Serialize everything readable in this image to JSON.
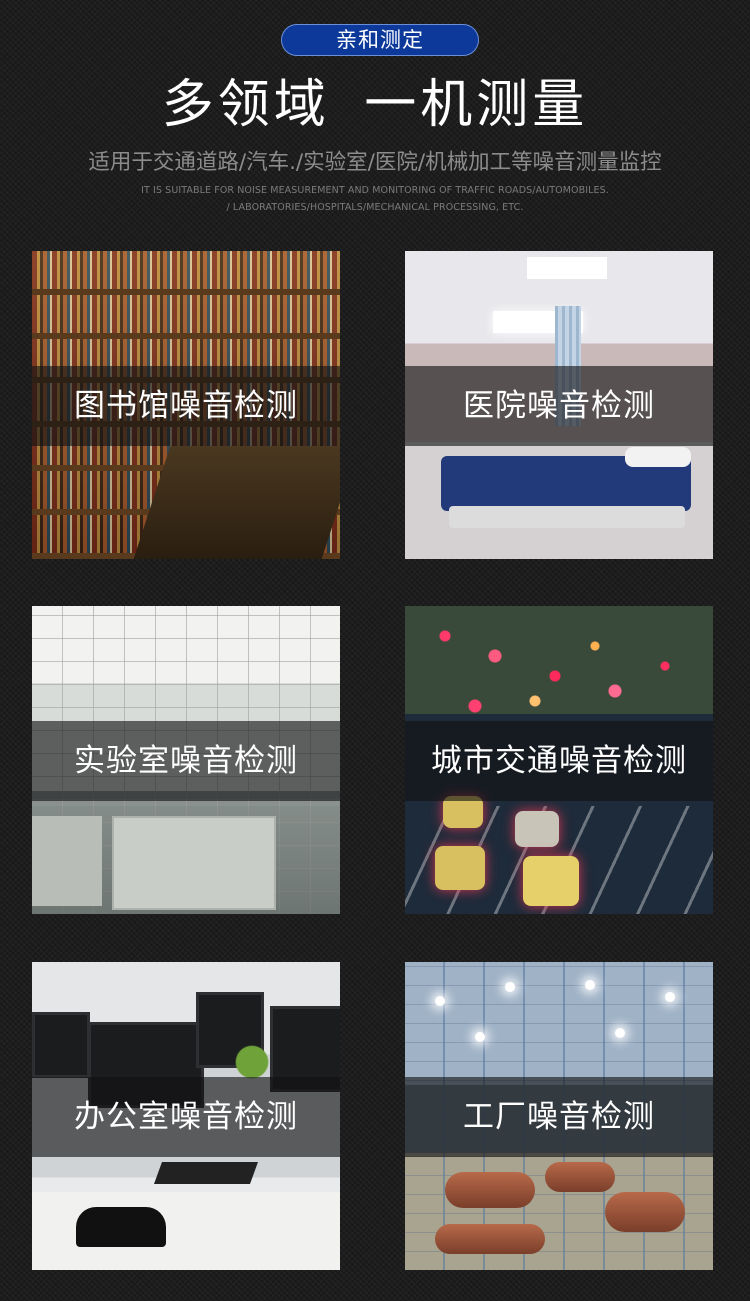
{
  "badge": {
    "label": "亲和测定",
    "color": "#0d3a9a"
  },
  "title": "多领域  一机测量",
  "subtitle_cn": "适用于交通道路/汽车./实验室/医院/机械加工等噪音测量监控",
  "subtitle_en": {
    "line1": "IT IS SUITABLE FOR NOISE MEASUREMENT AND MONITORING OF TRAFFIC ROADS/AUTOMOBILES.",
    "line2": "/ LABORATORIES/HOSPITALS/MECHANICAL PROCESSING, ETC."
  },
  "cards": [
    {
      "label": "图书馆噪音检测",
      "photo": "library-photo"
    },
    {
      "label": "医院噪音检测",
      "photo": "hospital-ward-photo"
    },
    {
      "label": "实验室噪音检测",
      "photo": "laboratory-photo"
    },
    {
      "label": "城市交通噪音检测",
      "photo": "traffic-night-photo"
    },
    {
      "label": "办公室噪音检测",
      "photo": "office-desk-photo"
    },
    {
      "label": "工厂噪音检测",
      "photo": "factory-floor-photo"
    }
  ]
}
